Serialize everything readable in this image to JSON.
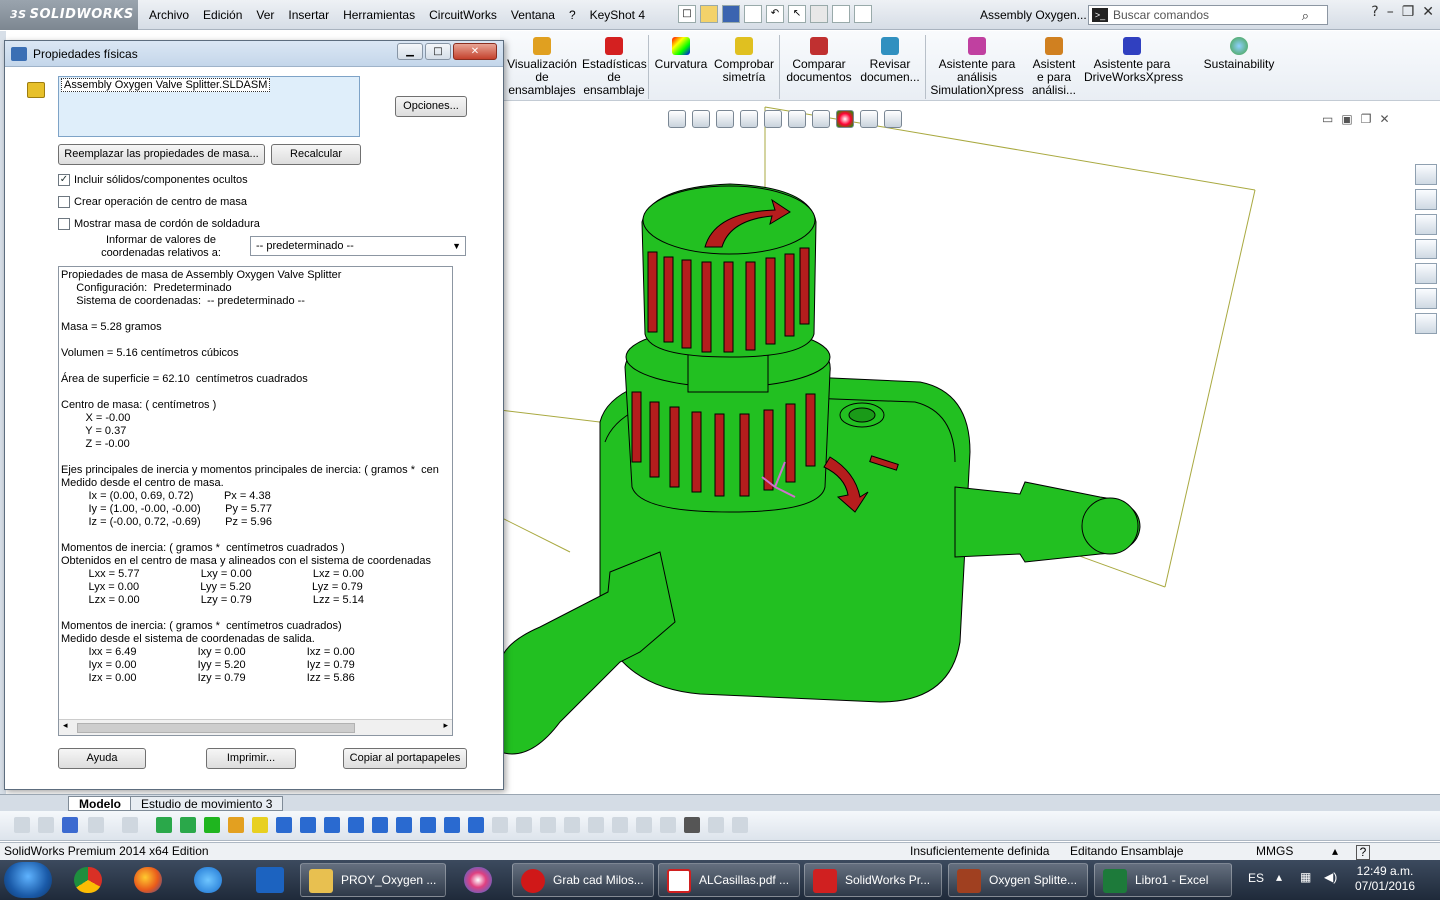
{
  "app": {
    "logo": "SOLIDWORKS",
    "menu": [
      "Archivo",
      "Edición",
      "Ver",
      "Insertar",
      "Herramientas",
      "CircuitWorks",
      "Ventana",
      "?",
      "KeyShot 4"
    ],
    "doc_title": "Assembly Oxygen...",
    "search_placeholder": "Buscar comandos"
  },
  "ribbon": {
    "buttons": [
      {
        "label": "Visualización\nde\nensamblajes",
        "icon": "assembly-visualization-icon",
        "color": "#e0a020"
      },
      {
        "label": "Estadísticas\nde\nensamblaje",
        "icon": "assembly-statistics-icon",
        "color": "#d42020"
      },
      {
        "label": "Curvatura",
        "icon": "curvature-icon",
        "color": "#c030c0"
      },
      {
        "label": "Comprobar\nsimetría",
        "icon": "symmetry-check-icon",
        "color": "#e0c020"
      },
      {
        "label": "Comparar\ndocumentos",
        "icon": "compare-documents-icon",
        "color": "#c03030"
      },
      {
        "label": "Revisar\ndocumen...",
        "icon": "review-document-icon",
        "color": "#3090c0"
      },
      {
        "label": "Asistente para\nanálisis\nSimulationXpress",
        "icon": "simulationxpress-icon",
        "color": "#c040a0"
      },
      {
        "label": "Asistent\ne para\nanálisi...",
        "icon": "analysis-wizard-icon",
        "color": "#d08020"
      },
      {
        "label": "Asistente para\nDriveWorksXpress",
        "icon": "driveworksxpress-icon",
        "color": "#3040c0"
      },
      {
        "label": "Sustainability",
        "icon": "sustainability-icon",
        "color": "#40a040"
      }
    ]
  },
  "dialog": {
    "title": "Propiedades físicas",
    "file": "Assembly Oxygen Valve Splitter.SLDASM",
    "options_btn": "Opciones...",
    "replace_btn": "Reemplazar las propiedades de masa...",
    "recalc_btn": "Recalcular",
    "checkboxes": [
      {
        "label": "Incluir sólidos/componentes ocultos",
        "checked": "✓"
      },
      {
        "label": "Crear operación de centro de masa",
        "checked": ""
      },
      {
        "label": "Mostrar masa de cordón de soldadura",
        "checked": ""
      }
    ],
    "coord_label": "Informar de valores de coordenadas relativos a:",
    "coord_value": "-- predeterminado --",
    "results": [
      "Propiedades de masa de Assembly Oxygen Valve Splitter",
      "     Configuración:  Predeterminado",
      "     Sistema de coordenadas:  -- predeterminado --",
      "",
      "Masa = 5.28 gramos",
      "",
      "Volumen = 5.16 centímetros cúbicos",
      "",
      "Área de superficie = 62.10  centímetros cuadrados",
      "",
      "Centro de masa: ( centímetros )",
      "        X = -0.00",
      "        Y = 0.37",
      "        Z = -0.00",
      "",
      "Ejes principales de inercia y momentos principales de inercia: ( gramos *  cen",
      "Medido desde el centro de masa.",
      "         Ix = (0.00, 0.69, 0.72)          Px = 4.38",
      "         Iy = (1.00, -0.00, -0.00)        Py = 5.77",
      "         Iz = (-0.00, 0.72, -0.69)        Pz = 5.96",
      "",
      "Momentos de inercia: ( gramos *  centímetros cuadrados )",
      "Obtenidos en el centro de masa y alineados con el sistema de coordenadas",
      "         Lxx = 5.77                    Lxy = 0.00                    Lxz = 0.00",
      "         Lyx = 0.00                    Lyy = 5.20                    Lyz = 0.79",
      "         Lzx = 0.00                    Lzy = 0.79                    Lzz = 5.14",
      "",
      "Momentos de inercia: ( gramos *  centímetros cuadrados)",
      "Medido desde el sistema de coordenadas de salida.",
      "         Ixx = 6.49                    Ixy = 0.00                    Ixz = 0.00",
      "         Iyx = 0.00                    Iyy = 5.20                    Iyz = 0.79",
      "         Izx = 0.00                    Izy = 0.79                    Izz = 5.86"
    ],
    "help_btn": "Ayuda",
    "print_btn": "Imprimir...",
    "copy_btn": "Copiar al portapapeles"
  },
  "tabs": {
    "model": "Modelo",
    "motion": "Estudio de movimiento 3"
  },
  "status": {
    "edition": "SolidWorks Premium 2014 x64 Edition",
    "definition": "Insuficientemente definida",
    "mode": "Editando Ensamblaje",
    "units": "MMGS",
    "help": "?"
  },
  "taskbar": {
    "items": [
      {
        "label": "PROY_Oxygen ...",
        "icon": "folder-icon",
        "color": "#e8c050"
      },
      {
        "label": "Grab cad Milos...",
        "icon": "opera-icon",
        "color": "#d01818"
      },
      {
        "label": "ALCasillas.pdf ...",
        "icon": "pdf-icon",
        "color": "#d02020"
      },
      {
        "label": "SolidWorks Pr...",
        "icon": "solidworks-icon",
        "color": "#d02020"
      },
      {
        "label": "Oxygen Splitte...",
        "icon": "keyshot-icon",
        "color": "#a04020"
      },
      {
        "label": "Libro1 - Excel",
        "icon": "excel-icon",
        "color": "#1d7a3a"
      }
    ],
    "lang": "ES",
    "time": "12:49 a.m.",
    "date": "07/01/2016"
  },
  "colors": {
    "model_green": "#22c021",
    "model_red": "#b51d1d",
    "bbox_line": "#a9a940"
  }
}
